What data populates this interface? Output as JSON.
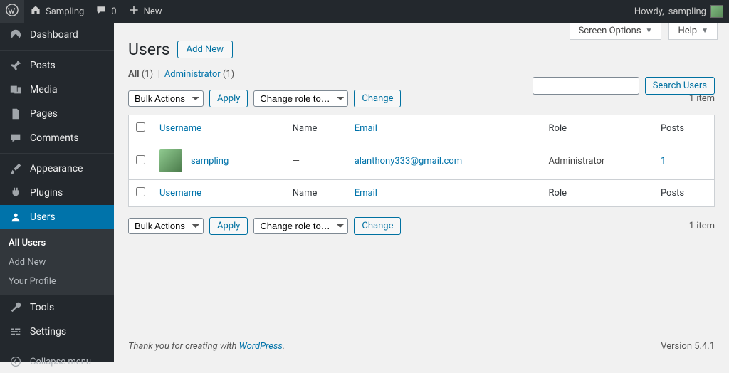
{
  "adminbar": {
    "site_name": "Sampling",
    "comments_count": "0",
    "new_label": "New",
    "howdy_prefix": "Howdy, ",
    "howdy_user": "sampling"
  },
  "sidebar": {
    "items": [
      {
        "label": "Dashboard",
        "icon": "dashboard"
      },
      {
        "label": "Posts",
        "icon": "pin"
      },
      {
        "label": "Media",
        "icon": "media"
      },
      {
        "label": "Pages",
        "icon": "pages"
      },
      {
        "label": "Comments",
        "icon": "comment"
      },
      {
        "label": "Appearance",
        "icon": "brush"
      },
      {
        "label": "Plugins",
        "icon": "plug"
      },
      {
        "label": "Users",
        "icon": "user"
      },
      {
        "label": "Tools",
        "icon": "wrench"
      },
      {
        "label": "Settings",
        "icon": "sliders"
      }
    ],
    "submenu": [
      "All Users",
      "Add New",
      "Your Profile"
    ],
    "collapse": "Collapse menu"
  },
  "toolbar": {
    "screen_options": "Screen Options",
    "help": "Help"
  },
  "page": {
    "title": "Users",
    "add_new": "Add New"
  },
  "filters": {
    "all": "All",
    "all_count": "(1)",
    "admin": "Administrator",
    "admin_count": "(1)"
  },
  "search": {
    "button": "Search Users"
  },
  "bulk": {
    "bulk_label": "Bulk Actions",
    "apply": "Apply",
    "role_label": "Change role to…",
    "change": "Change",
    "count": "1 item"
  },
  "columns": {
    "username": "Username",
    "name": "Name",
    "email": "Email",
    "role": "Role",
    "posts": "Posts"
  },
  "rows": [
    {
      "username": "sampling",
      "name": "—",
      "email": "alanthony333@gmail.com",
      "role": "Administrator",
      "posts": "1"
    }
  ],
  "footer": {
    "thankyou_prefix": "Thank you for creating with ",
    "wp": "WordPress",
    "version": "Version 5.4.1"
  }
}
